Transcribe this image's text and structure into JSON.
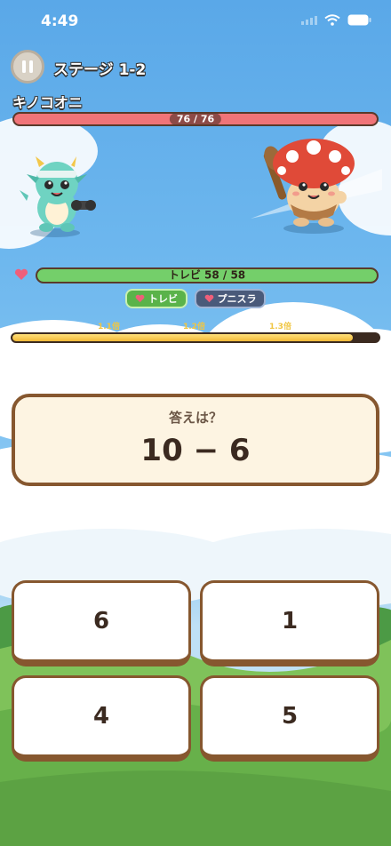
{
  "status_bar": {
    "time": "4:49"
  },
  "header": {
    "stage": "ステージ 1-2"
  },
  "enemy": {
    "name": "キノコオニ",
    "hp_text": "76 / 76",
    "hp_fraction": 1.0
  },
  "player": {
    "hp_text": "トレビ  58 / 58",
    "hp_fraction": 1.0
  },
  "party": [
    {
      "name": "トレビ",
      "active": true
    },
    {
      "name": "プニスラ",
      "active": false
    }
  ],
  "combo": {
    "multipliers": [
      "1.1倍",
      "1.2倍",
      "1.3倍"
    ],
    "progress": 0.93
  },
  "question": {
    "prompt": "答えは？",
    "expression": "10 − 6"
  },
  "answers": [
    "6",
    "1",
    "4",
    "5"
  ],
  "colors": {
    "enemy_hp": "#f07478",
    "player_hp": "#74cf6a",
    "frame": "#86572f",
    "text_dark": "#3b2a20"
  }
}
